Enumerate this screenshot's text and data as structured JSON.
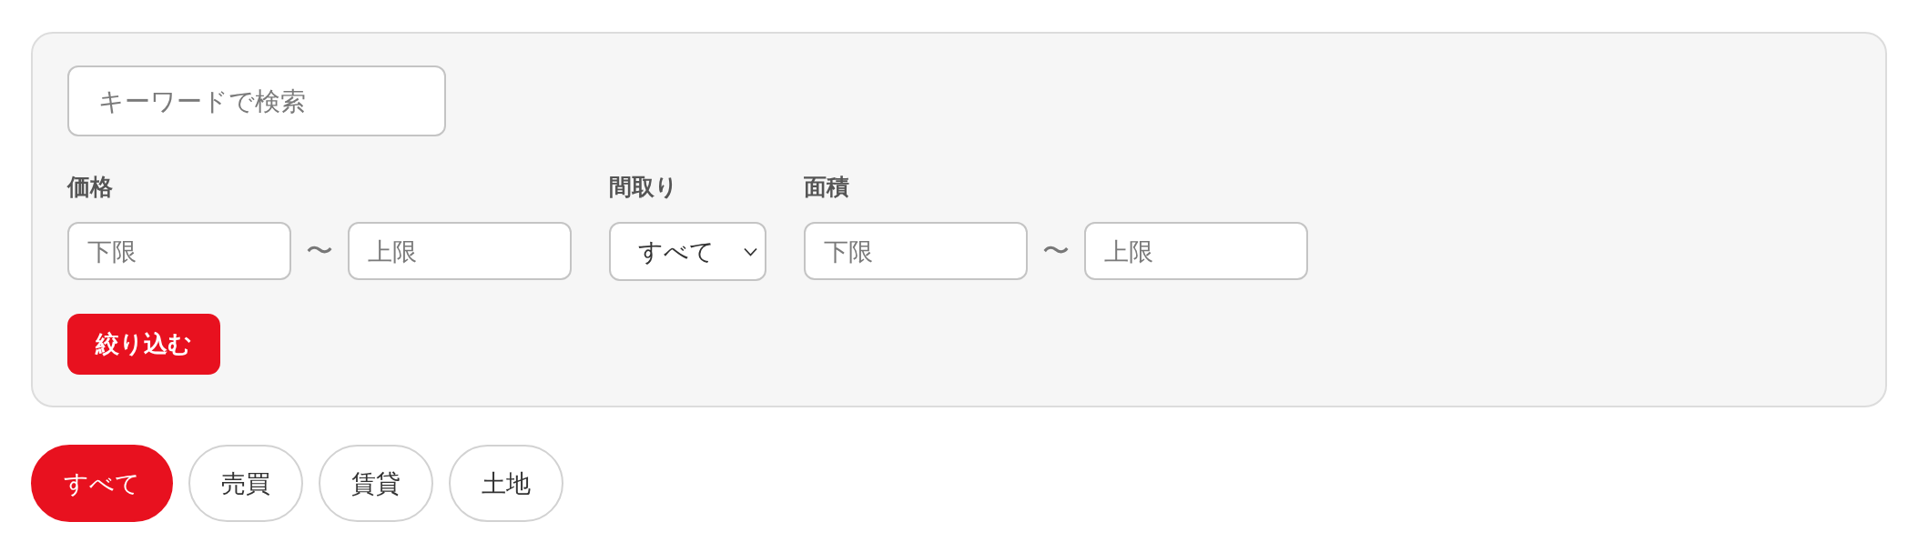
{
  "search": {
    "placeholder": "キーワードで検索"
  },
  "filters": [
    {
      "kind": "range",
      "label": "価格",
      "fields": [
        {
          "placeholder": "下限"
        },
        {
          "placeholder": "上限"
        }
      ],
      "separator": "〜"
    },
    {
      "kind": "select",
      "label": "間取り",
      "value": "すべて"
    },
    {
      "kind": "range",
      "label": "面積",
      "fields": [
        {
          "placeholder": "下限"
        },
        {
          "placeholder": "上限"
        }
      ],
      "separator": "〜"
    }
  ],
  "submit_button": "絞り込む",
  "categories": [
    {
      "label": "すべて",
      "selected": true
    },
    {
      "label": "売買",
      "selected": false
    },
    {
      "label": "賃貸",
      "selected": false
    },
    {
      "label": "土地",
      "selected": false
    }
  ]
}
